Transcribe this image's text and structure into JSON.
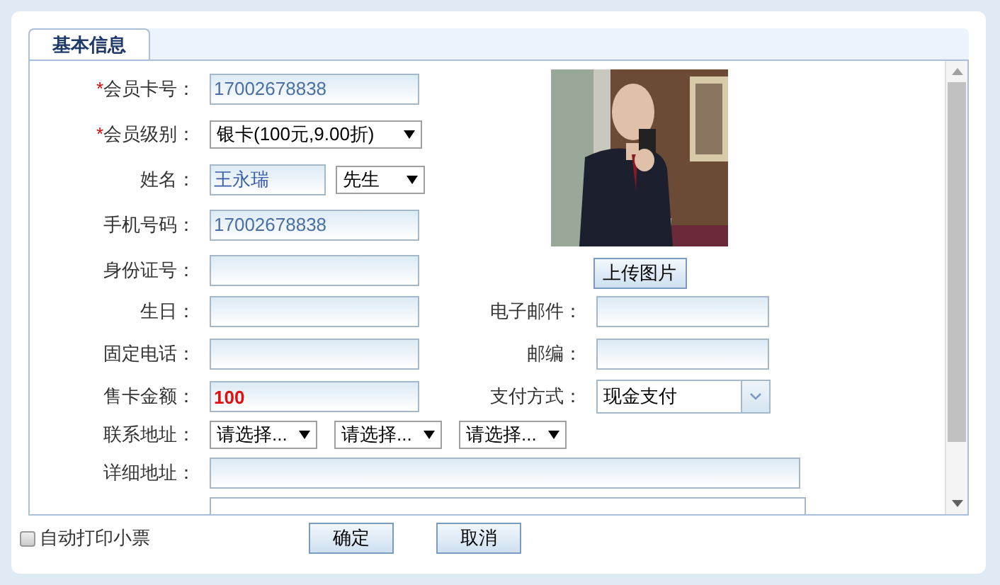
{
  "tab": {
    "label": "基本信息",
    "selected": true
  },
  "top_fields": [
    {
      "label": "会员卡号：",
      "required_mark": "*",
      "kind": "text",
      "value": "17002678838"
    },
    {
      "label": "会员级别：",
      "required_mark": "*",
      "kind": "select",
      "value": "银卡(100元,9.00折)"
    },
    {
      "label": "姓名：",
      "kind": "name",
      "value": "王永瑞",
      "title": "先生"
    },
    {
      "label": "手机号码：",
      "kind": "text",
      "value": "17002678838"
    },
    {
      "label": "身份证号：",
      "kind": "text"
    }
  ],
  "photo": {
    "kind": "picture"
  },
  "upload_button": "上传图片",
  "paired_rows": [
    [
      {
        "label": "生日：",
        "kind": "text"
      },
      {
        "label": "电子邮件：",
        "kind": "text"
      }
    ],
    [
      {
        "label": "固定电话：",
        "kind": "text"
      },
      {
        "label": "邮编：",
        "kind": "text"
      }
    ],
    [
      {
        "label": "售卡金额：",
        "kind": "text",
        "value": "100",
        "highlight": true
      },
      {
        "label": "支付方式：",
        "kind": "combo",
        "value": "现金支付"
      }
    ]
  ],
  "address": {
    "label": "联系地址：",
    "selects": [
      "请选择...",
      "请选择...",
      "请选择..."
    ]
  },
  "detail_address": {
    "label": "详细地址："
  },
  "auto_print": {
    "label": "自动打印小票",
    "checked": false
  },
  "buttons": [
    "确定",
    "取消"
  ]
}
